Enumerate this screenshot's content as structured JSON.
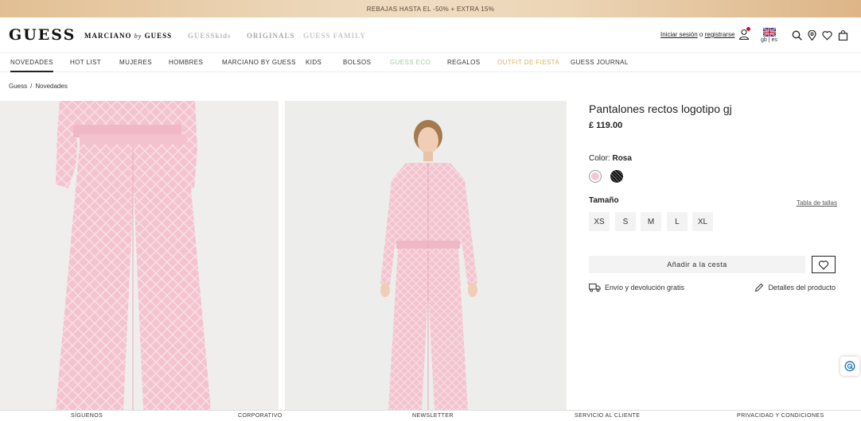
{
  "promo": {
    "text": "REBAJAS HASTA EL -50% + EXTRA 15%"
  },
  "header": {
    "logo": "GUESS",
    "brands": {
      "marciano_a": "MARCIANO",
      "marciano_by": "by",
      "marciano_b": "GUESS",
      "kids": "GUESSkids",
      "originals": "ORIGINALS",
      "family": "GUESS FAMILY"
    },
    "login": "Iniciar sesión",
    "login_or": "o",
    "register": "registrarse",
    "locale": "gb | es",
    "icons": [
      "user-icon",
      "search-icon",
      "store-locator-icon",
      "heart-icon",
      "bag-icon"
    ]
  },
  "nav": {
    "items": [
      "NOVEDADES",
      "HOT LIST",
      "MUJERES",
      "HOMBRES",
      "MARCIANO BY GUESS",
      "KIDS",
      "BOLSOS",
      "GUESS ECO",
      "REGALOS",
      "OUTFIT DE FIESTA",
      "GUESS JOURNAL"
    ],
    "active": "NOVEDADES"
  },
  "breadcrumb": {
    "root": "Guess",
    "sep": "/",
    "current": "Novedades"
  },
  "product": {
    "title": "Pantalones rectos logotipo gj",
    "price": "£ 119.00",
    "color_label": "Color:",
    "color_value": "Rosa",
    "size_label": "Tamaño",
    "size_chart": "Tabla de tallas",
    "sizes": [
      "XS",
      "S",
      "M",
      "L",
      "XL"
    ],
    "add_to_cart": "Añadir a la cesta",
    "shipping": "Envío y devolución gratis",
    "details": "Detalles del producto",
    "colors": {
      "rosa": "#f4c7d3",
      "accent": "#c8102e"
    }
  },
  "footer": {
    "items": [
      "SÍGUENOS",
      "CORPORATIVO",
      "NEWSLETTER",
      "SERVICIO AL CLIENTE",
      "PRIVACIDAD Y CONDICIONES"
    ]
  }
}
